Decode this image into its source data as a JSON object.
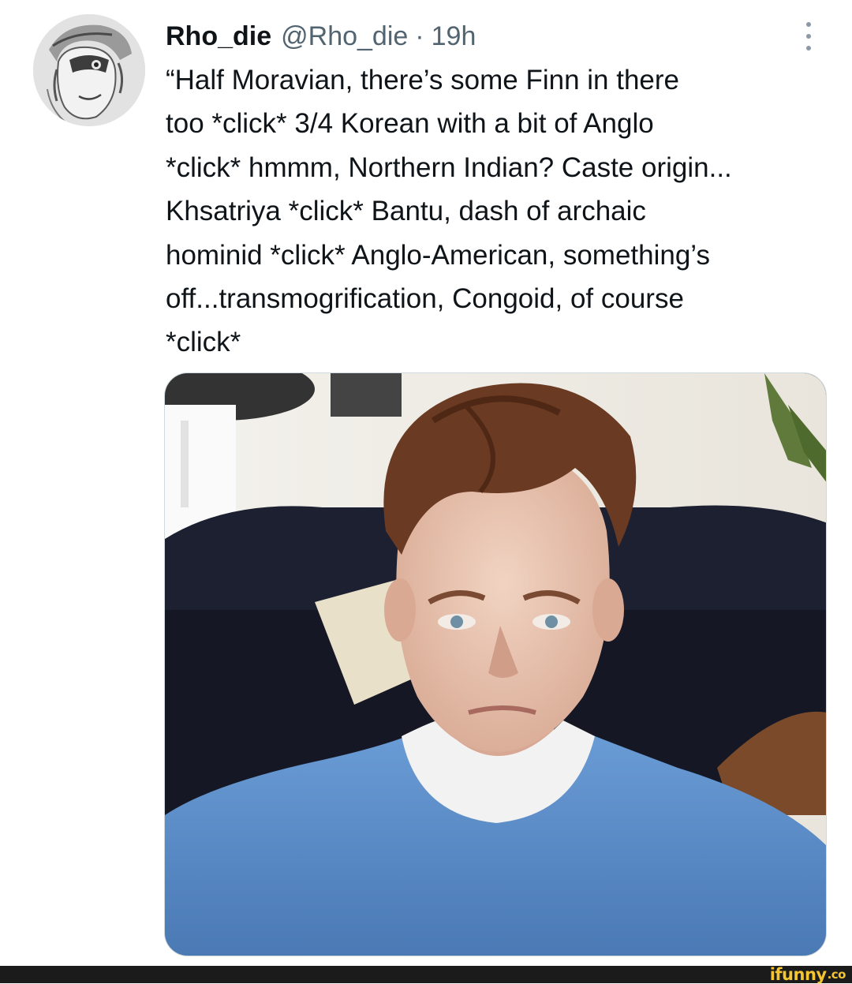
{
  "tweet": {
    "display_name": "Rho_die",
    "handle": "@Rho_die",
    "separator": "·",
    "time": "19h",
    "text": "“Half Moravian, there’s some Finn in there\ntoo *click* 3/4 Korean with a bit of Anglo\n*click* hmmm, Northern Indian? Caste origin...\nKhsatriya *click* Bantu, dash of archaic\nhominid *click* Anglo-American, something’s\noff...transmogrification, Congoid, of course\n*click*"
  },
  "icons": {
    "more": "more-vertical-icon",
    "avatar": "avatar-image"
  },
  "watermark": {
    "main": "ifunny",
    "suffix": ".co"
  },
  "colors": {
    "text_primary": "#0f1419",
    "text_secondary": "#536471",
    "watermark": "#f4c531",
    "footer_bar": "#1b1b1b"
  }
}
